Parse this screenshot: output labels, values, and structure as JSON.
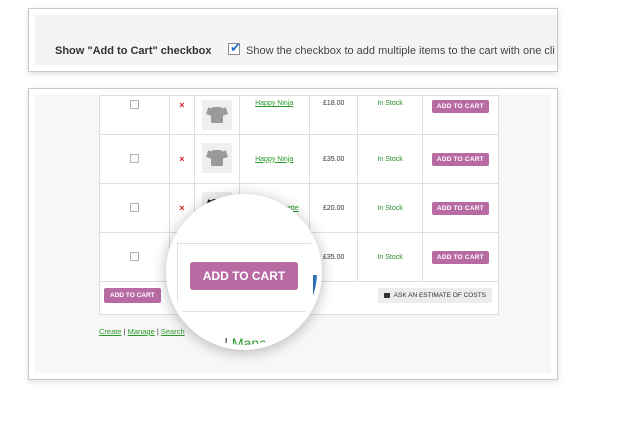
{
  "setting": {
    "label": "Show \"Add to Cart\" checkbox",
    "checked_mark": "✔",
    "description": "Show the checkbox to add multiple items to the cart with one cli"
  },
  "table": {
    "rows": [
      {
        "name": "Happy Ninja",
        "price": "£18.00",
        "stock": "In Stock",
        "button": "ADD TO CART"
      },
      {
        "name": "Happy Ninja",
        "price": "£35.00",
        "stock": "In Stock",
        "button": "ADD TO CART"
      },
      {
        "name": "Ninja Silhouette",
        "price": "£20.00",
        "stock": "In Stock",
        "button": "ADD TO CART"
      },
      {
        "name": "",
        "price": "£35.00",
        "stock": "In Stock",
        "button": "ADD TO CART"
      }
    ],
    "remove_symbol": "×",
    "add_all_button": "ADD TO CART",
    "estimate_button": "ASK AN ESTIMATE OF COSTS"
  },
  "links": {
    "create": "Create",
    "manage": "Manage",
    "search": "Search",
    "sep": " | "
  },
  "magnifier": {
    "button": "ADD TO CART",
    "link_partial": "ate",
    "manage": "Manage",
    "sep": " | "
  }
}
